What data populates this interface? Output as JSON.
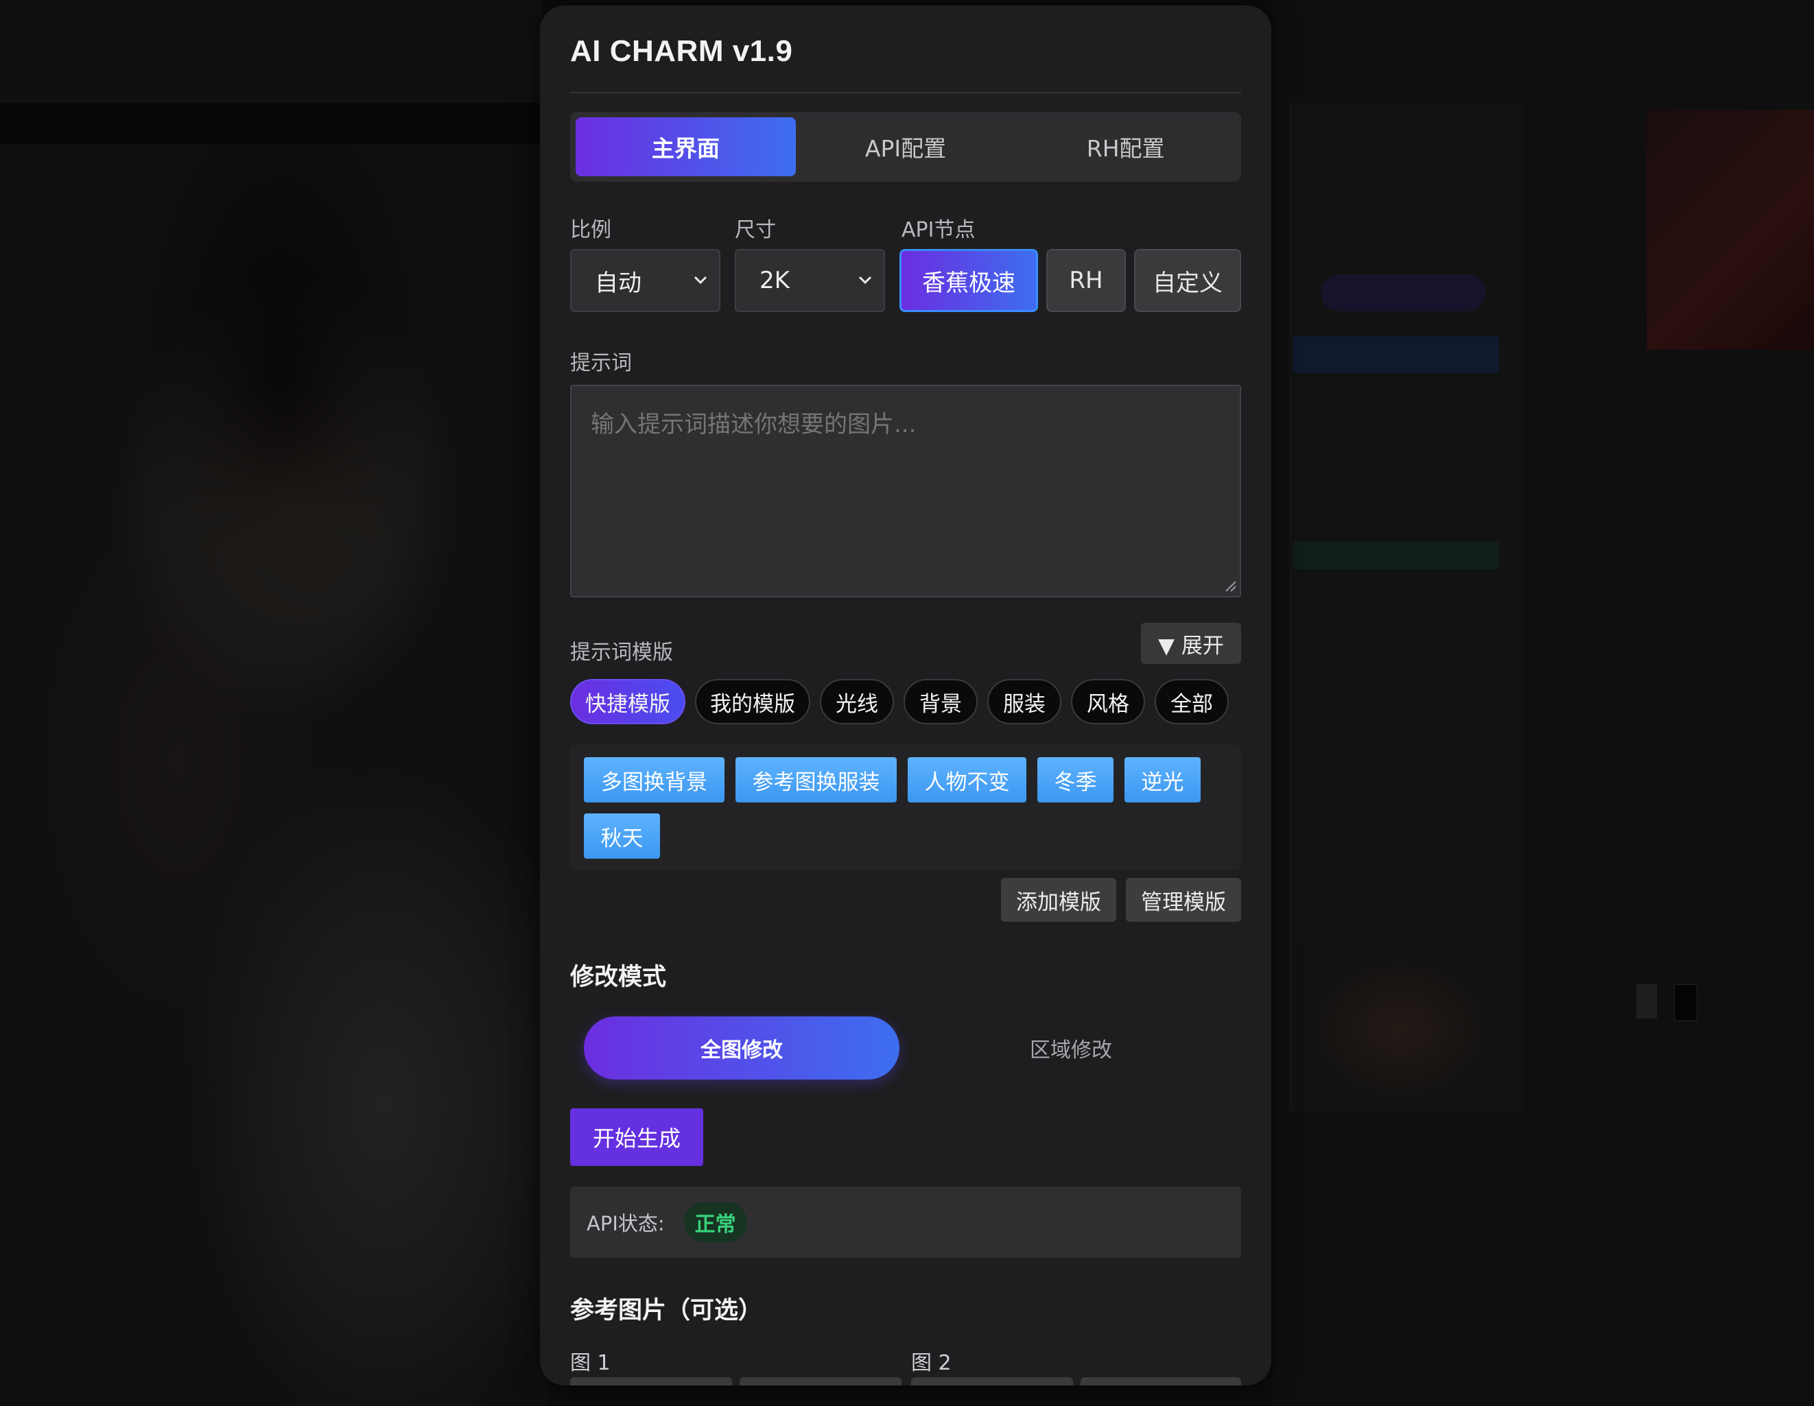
{
  "app": {
    "title": "AI CHARM v1.9"
  },
  "tabs": [
    {
      "label": "主界面",
      "active": true
    },
    {
      "label": "API配置",
      "active": false
    },
    {
      "label": "RH配置",
      "active": false
    }
  ],
  "settings": {
    "ratio_label": "比例",
    "ratio_value": "自动",
    "size_label": "尺寸",
    "size_value": "2K",
    "node_label": "API节点",
    "nodes": [
      {
        "label": "香蕉极速",
        "active": true
      },
      {
        "label": "RH",
        "active": false
      },
      {
        "label": "自定义",
        "active": false
      }
    ]
  },
  "prompt": {
    "label": "提示词",
    "placeholder": "输入提示词描述你想要的图片...",
    "value": ""
  },
  "templates": {
    "label": "提示词模版",
    "expand_label": "▼ 展开",
    "categories": [
      {
        "label": "快捷模版",
        "active": true
      },
      {
        "label": "我的模版",
        "active": false
      },
      {
        "label": "光线",
        "active": false
      },
      {
        "label": "背景",
        "active": false
      },
      {
        "label": "服装",
        "active": false
      },
      {
        "label": "风格",
        "active": false
      },
      {
        "label": "全部",
        "active": false
      }
    ],
    "chips": [
      "多图换背景",
      "参考图换服装",
      "人物不变",
      "冬季",
      "逆光",
      "秋天"
    ],
    "add_label": "添加模版",
    "manage_label": "管理模版"
  },
  "mode": {
    "title": "修改模式",
    "options": [
      {
        "label": "全图修改",
        "active": true
      },
      {
        "label": "区域修改",
        "active": false
      }
    ]
  },
  "actions": {
    "start_label": "开始生成"
  },
  "status": {
    "label": "API状态:",
    "value": "正常",
    "color": "#38d37a"
  },
  "reference": {
    "title": "参考图片（可选）",
    "image1_label": "图 1",
    "image2_label": "图 2"
  },
  "colors": {
    "accent_start": "#6b2ee0",
    "accent_end": "#3d6ef0",
    "chip_blue": "#4aa6f8",
    "panel_bg": "#1e1e20"
  }
}
